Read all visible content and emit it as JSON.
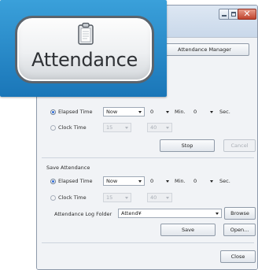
{
  "callout": {
    "label": "Attendance",
    "icon": "clipboard-icon"
  },
  "dialog": {
    "manager_button": "Attendance Manager",
    "close_button": "Close"
  },
  "stop_section": {
    "elapsed_label": "Elapsed Time",
    "elapsed_value": "Now",
    "elapsed_min": "0",
    "min_unit": "Min.",
    "elapsed_sec": "0",
    "sec_unit": "Sec.",
    "clock_label": "Clock Time",
    "clock_hour": "15",
    "clock_min": "40",
    "stop_button": "Stop",
    "cancel_button": "Cancel"
  },
  "save_section": {
    "title": "Save Attendance",
    "elapsed_label": "Elapsed Time",
    "elapsed_value": "Now",
    "elapsed_min": "0",
    "min_unit": "Min.",
    "elapsed_sec": "0",
    "sec_unit": "Sec.",
    "clock_label": "Clock Time",
    "clock_hour": "15",
    "clock_min": "40",
    "folder_label": "Attendance Log Folder",
    "folder_value": "Attend¥",
    "browse_button": "Browse",
    "save_button": "Save",
    "open_button": "Open..."
  },
  "colors": {
    "callout_background": "#2a8ccb",
    "accent_radio": "#2f6bd6",
    "close_button": "#c0432d"
  }
}
